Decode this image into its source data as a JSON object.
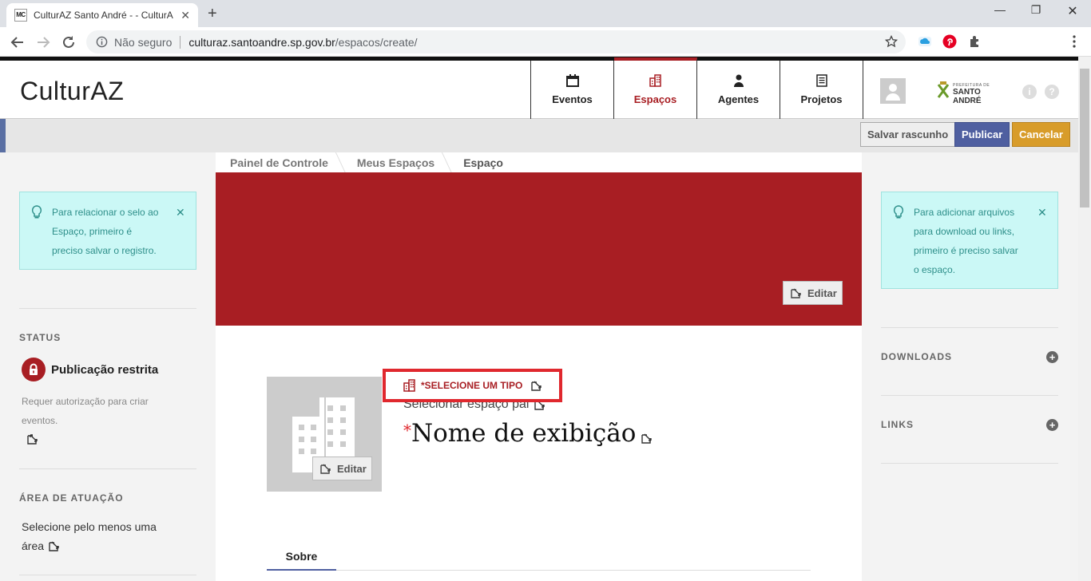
{
  "browser": {
    "tab_title": "CulturAZ Santo André - - CulturAZ",
    "favicon_text": "MC",
    "security_label": "Não seguro",
    "url_host": "culturaz.santoandre.sp.gov.br",
    "url_path": "/espacos/create/"
  },
  "site": {
    "logo": "CulturAZ",
    "nav": [
      {
        "label": "Eventos",
        "icon": "calendar-icon"
      },
      {
        "label": "Espaços",
        "icon": "building-icon",
        "active": true
      },
      {
        "label": "Agentes",
        "icon": "person-icon"
      },
      {
        "label": "Projetos",
        "icon": "document-icon"
      }
    ],
    "prefeitura_small": "PREFEITURA DE",
    "prefeitura_name": "SANTO ANDRÉ",
    "help": "?",
    "info": "i"
  },
  "actions": {
    "draft": "Salvar rascunho",
    "publish": "Publicar",
    "cancel": "Cancelar"
  },
  "breadcrumb": [
    "Painel de Controle",
    "Meus Espaços",
    "Espaço"
  ],
  "left": {
    "alert_lines": [
      "Para relacionar o selo ao",
      "Espaço, primeiro é",
      "preciso salvar o registro."
    ],
    "status_label": "STATUS",
    "status_value": "Publicação restrita",
    "status_note_lines": [
      "Requer autorização para criar",
      "eventos."
    ],
    "area_label": "ÁREA DE ATUAÇÃO",
    "area_lines": [
      "Selecione pelo menos uma",
      "área"
    ]
  },
  "right": {
    "alert_lines": [
      "Para adicionar arquivos",
      "para download ou links,",
      "primeiro é preciso salvar",
      "o espaço."
    ],
    "downloads_label": "DOWNLOADS",
    "links_label": "LINKS"
  },
  "main": {
    "edit_cover": "Editar",
    "edit_avatar": "Editar",
    "type_prompt": "*SELECIONE UM TIPO",
    "parent_prompt": "Selecionar espaço pai",
    "name_required": "*",
    "name_placeholder": "Nome de exibição",
    "tab_about": "Sobre"
  },
  "colors": {
    "brand_red": "#a81e23",
    "publish_blue": "#4f5fa0",
    "cancel_gold": "#d89c2a",
    "alert_bg": "#cbf8f6"
  }
}
